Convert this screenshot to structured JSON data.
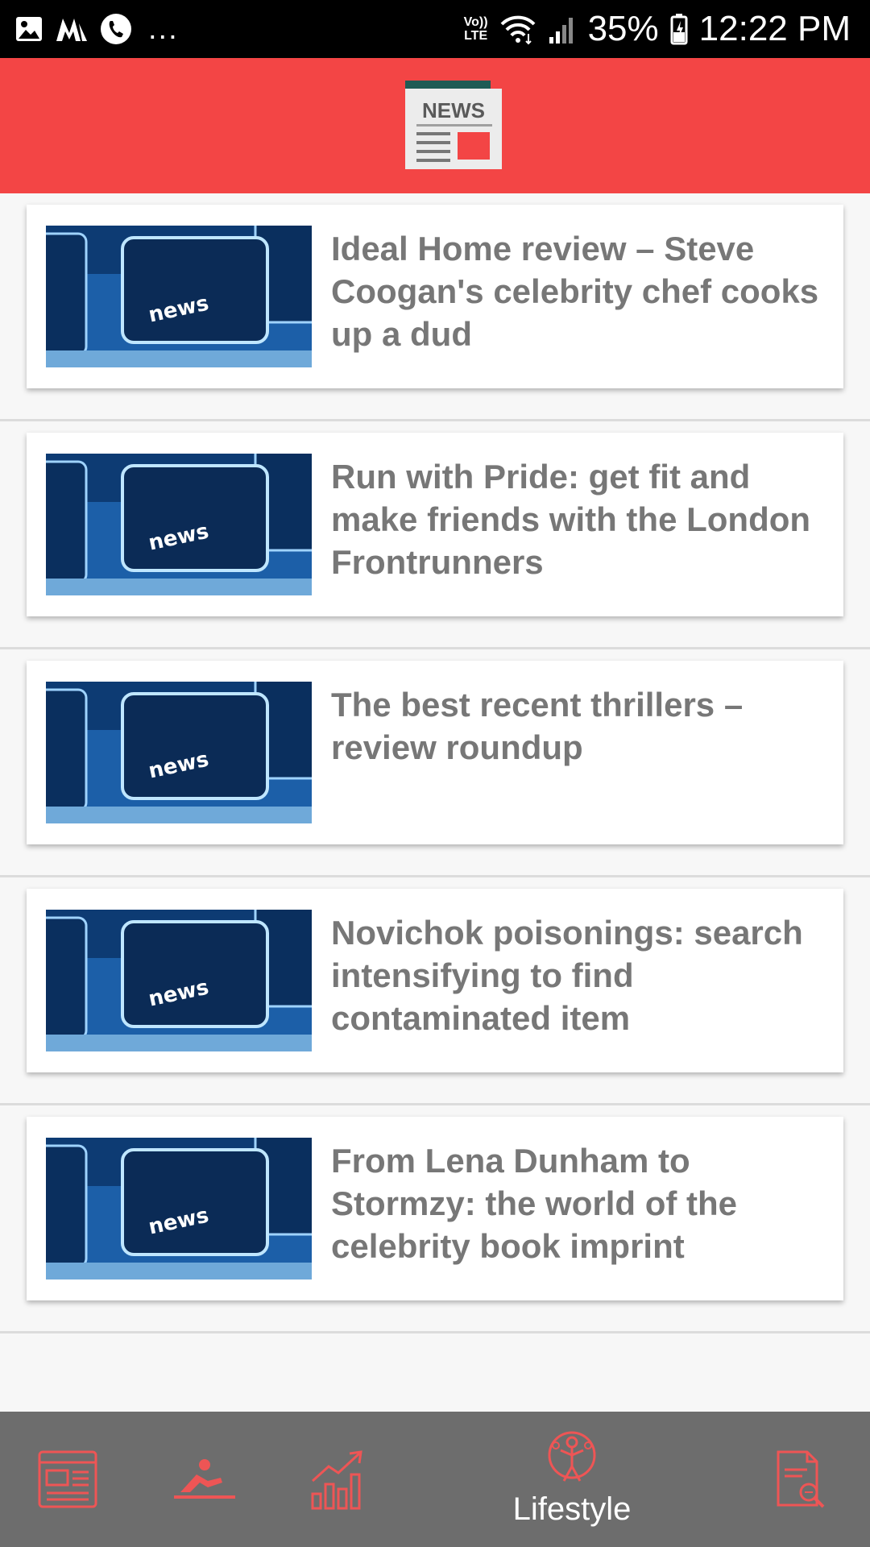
{
  "status_bar": {
    "left_icons": [
      "gallery-icon",
      "app-m-icon",
      "phone-icon"
    ],
    "overflow": "...",
    "volte_line1": "Vo))",
    "volte_line2": "LTE",
    "battery": "35%",
    "time": "12:22 PM"
  },
  "header": {
    "logo_text": "NEWS",
    "colors": {
      "accent": "#f34545",
      "nav": "#6d6d6d"
    }
  },
  "articles": [
    {
      "thumb_label": "news",
      "title": "Ideal Home review – Steve Coogan's celebrity chef cooks up a dud"
    },
    {
      "thumb_label": "news",
      "title": "Run with Pride: get fit and make friends with the London Frontrunners"
    },
    {
      "thumb_label": "news",
      "title": "The best recent thrillers – review roundup"
    },
    {
      "thumb_label": "news",
      "title": "Novichok poisonings: search intensifying to find contaminated item"
    },
    {
      "thumb_label": "news",
      "title": "From Lena Dunham to Stormzy: the world of the celebrity book imprint"
    }
  ],
  "bottom_nav": {
    "items": [
      {
        "icon": "newspaper-icon"
      },
      {
        "icon": "fitness-icon"
      },
      {
        "icon": "chart-icon"
      },
      {
        "icon": "lifestyle-icon",
        "label": "Lifestyle",
        "selected": true
      },
      {
        "icon": "search-document-icon"
      }
    ]
  }
}
